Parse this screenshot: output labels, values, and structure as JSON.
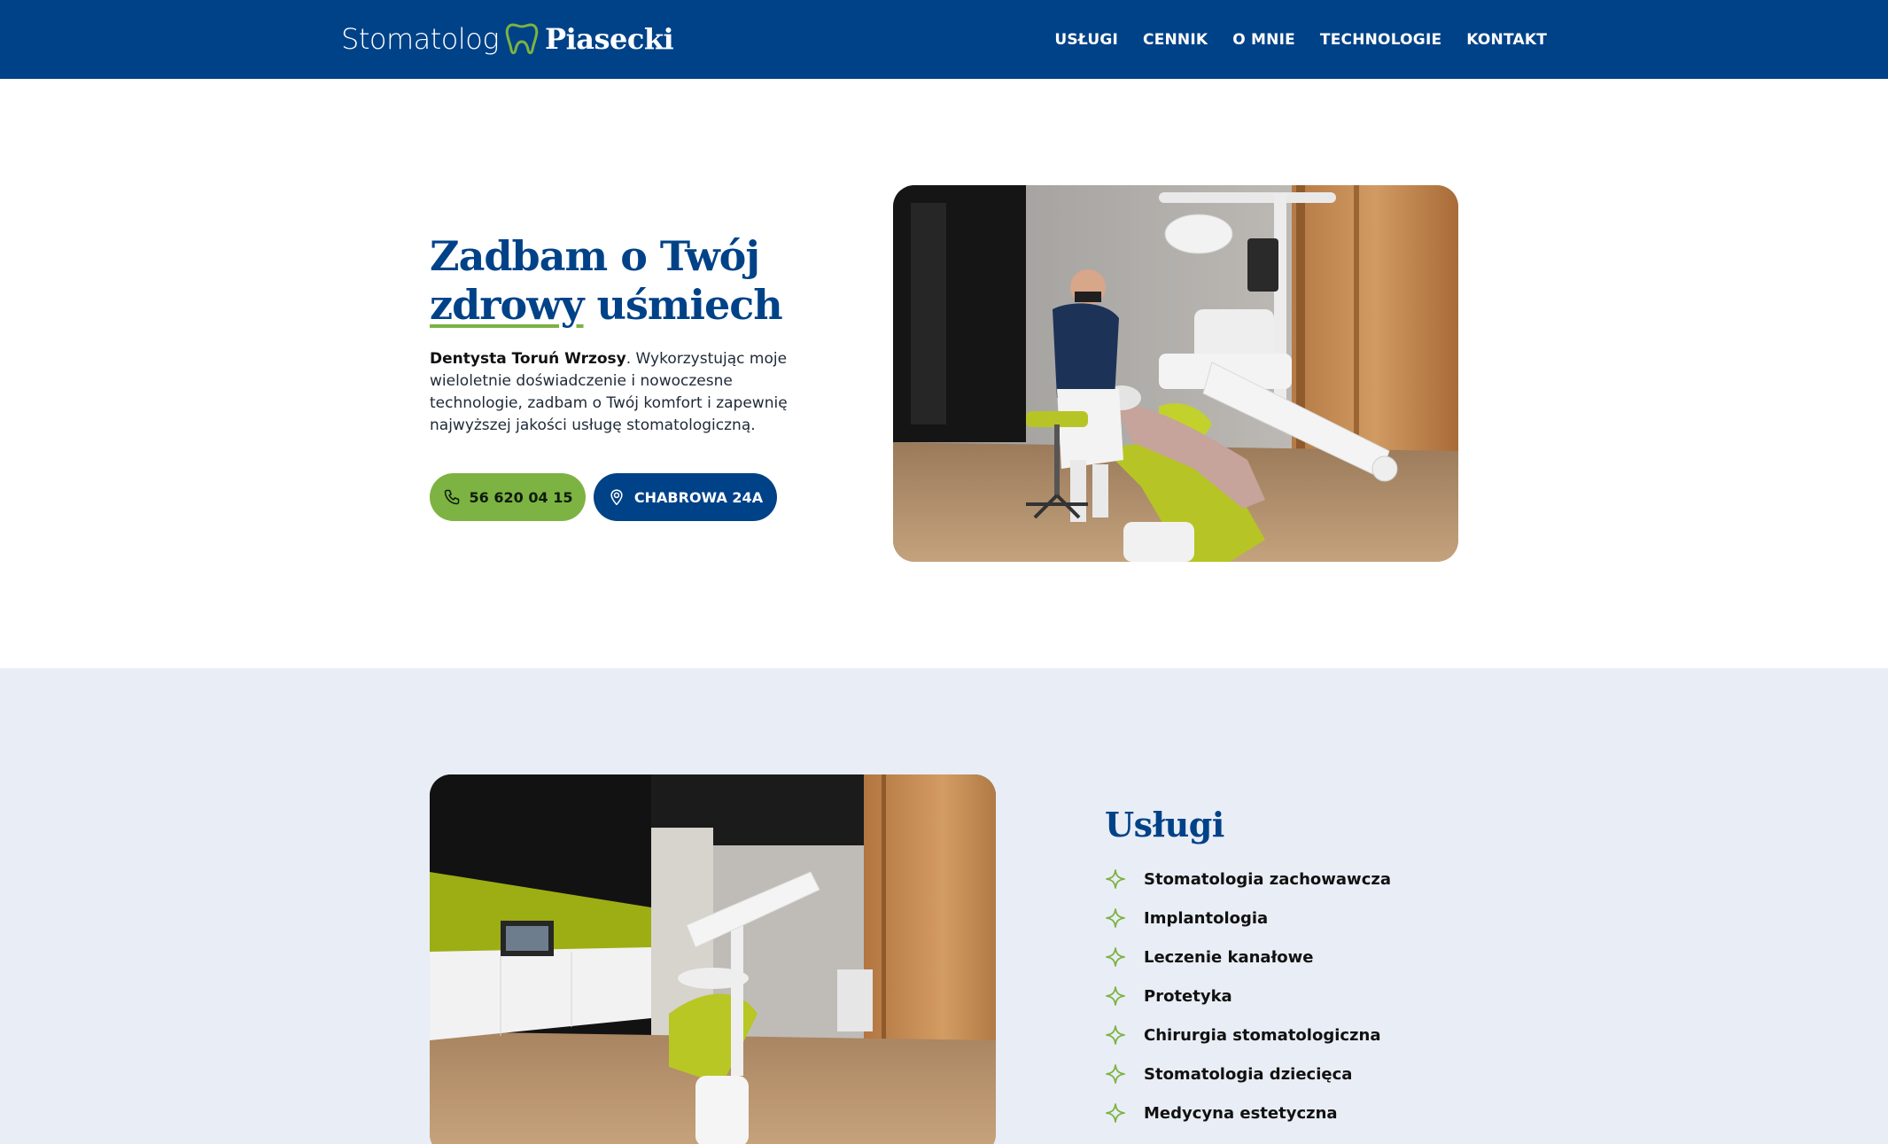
{
  "header": {
    "logo_light": "Stomatolog",
    "logo_bold": "Piasecki",
    "nav": [
      "USŁUGI",
      "CENNIK",
      "O MNIE",
      "TECHNOLOGIE",
      "KONTAKT"
    ]
  },
  "hero": {
    "title_line1": "Zadbam o Twój",
    "title_underlined": "zdrowy",
    "title_rest": " uśmiech",
    "desc_bold": "Dentysta Toruń Wrzosy",
    "desc_rest": ". Wykorzystując moje wieloletnie doświadczenie i nowoczesne technologie, zadbam o Twój komfort i zapewnię najwyższej jakości usługę stomatologiczną.",
    "phone_label": "56 620 04 15",
    "address_label": "CHABROWA 24A"
  },
  "services": {
    "title": "Usługi",
    "items": [
      "Stomatologia zachowawcza",
      "Implantologia",
      "Leczenie kanałowe",
      "Protetyka",
      "Chirurgia stomatologiczna",
      "Stomatologia dziecięca",
      "Medycyna estetyczna"
    ]
  },
  "colors": {
    "brand_blue": "#004288",
    "accent_green": "#7cb342",
    "section_bg": "#e9edf5"
  }
}
